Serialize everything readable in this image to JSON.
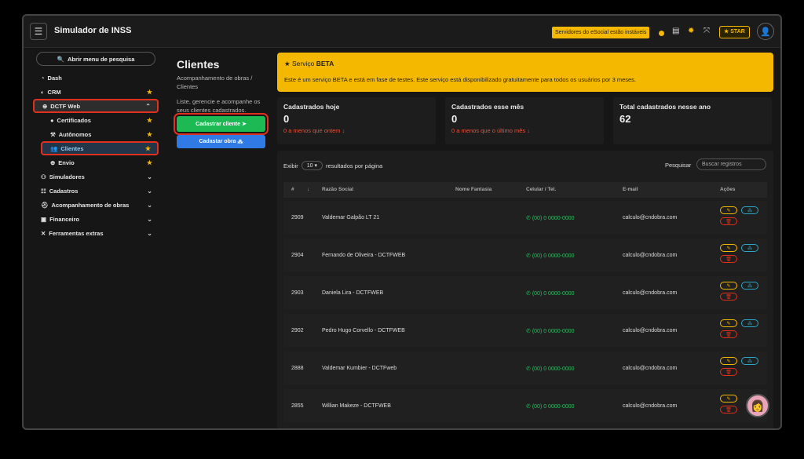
{
  "app": {
    "title": "Simulador de INSS"
  },
  "topbar": {
    "warning": "Servidores do eSocial estão instáveis",
    "star_label": "STAR"
  },
  "sidebar": {
    "search_label": "Abrir menu de pesquisa",
    "items": [
      {
        "label": "Dash"
      },
      {
        "label": "CRM"
      },
      {
        "label": "DCTF Web"
      },
      {
        "label": "Certificados"
      },
      {
        "label": "Autônomos"
      },
      {
        "label": "Clientes"
      },
      {
        "label": "Envio"
      },
      {
        "label": "Simuladores"
      },
      {
        "label": "Cadastros"
      },
      {
        "label": "Acompanhamento de obras"
      },
      {
        "label": "Financeiro"
      },
      {
        "label": "Ferramentas extras"
      }
    ]
  },
  "clients": {
    "title": "Clientes",
    "breadcrumb": "Acompanhamento de obras / Clientes",
    "description": "Liste, gerencie e acompanhe os seus clientes cadastrados.",
    "btn_add": "Cadastrar cliente",
    "btn_obra": "Cadastar obra"
  },
  "beta": {
    "title_prefix": "Serviço ",
    "title_bold": "BETA",
    "text": "Este é um serviço BETA e está em fase de testes. Este serviço está disponibilizado gratuitamente para todos os usuários por 3 meses."
  },
  "stats": [
    {
      "label": "Cadastrados hoje",
      "value": "0",
      "sub": "0 a menos que ontem ↓"
    },
    {
      "label": "Cadastrados esse mês",
      "value": "0",
      "sub": "0 a menos que o último mês ↓"
    },
    {
      "label": "Total cadastrados nesse ano",
      "value": "62",
      "sub": ""
    }
  ],
  "table": {
    "show_label": "Exibir",
    "page_size": "10",
    "per_page_label": "resultados por página",
    "search_label": "Pesquisar",
    "search_placeholder": "Buscar registros",
    "headers": [
      "#",
      "Razão Social",
      "Nome Fantasia",
      "Celular / Tel.",
      "E-mail",
      "Ações"
    ],
    "rows": [
      {
        "id": "2909",
        "name": "Valdemar Galpão LT 21",
        "fantasia": "",
        "phone": "(00) 0 0000-0000",
        "email": "calculo@cndobra.com"
      },
      {
        "id": "2904",
        "name": "Fernando de Oliveira - DCTFWEB",
        "fantasia": "",
        "phone": "(00) 0 0000-0000",
        "email": "calculo@cndobra.com"
      },
      {
        "id": "2903",
        "name": "Daniela Lira - DCTFWEB",
        "fantasia": "",
        "phone": "(00) 0 0000-0000",
        "email": "calculo@cndobra.com"
      },
      {
        "id": "2902",
        "name": "Pedro Hugo Corvello - DCTFWEB",
        "fantasia": "",
        "phone": "(00) 0 0000-0000",
        "email": "calculo@cndobra.com"
      },
      {
        "id": "2888",
        "name": "Valdemar Kumbier - DCTFweb",
        "fantasia": "",
        "phone": "(00) 0 0000-0000",
        "email": "calculo@cndobra.com"
      },
      {
        "id": "2855",
        "name": "Willian Makeze - DCTFWEB",
        "fantasia": "",
        "phone": "(00) 0 0000-0000",
        "email": "calculo@cndobra.com"
      }
    ]
  }
}
